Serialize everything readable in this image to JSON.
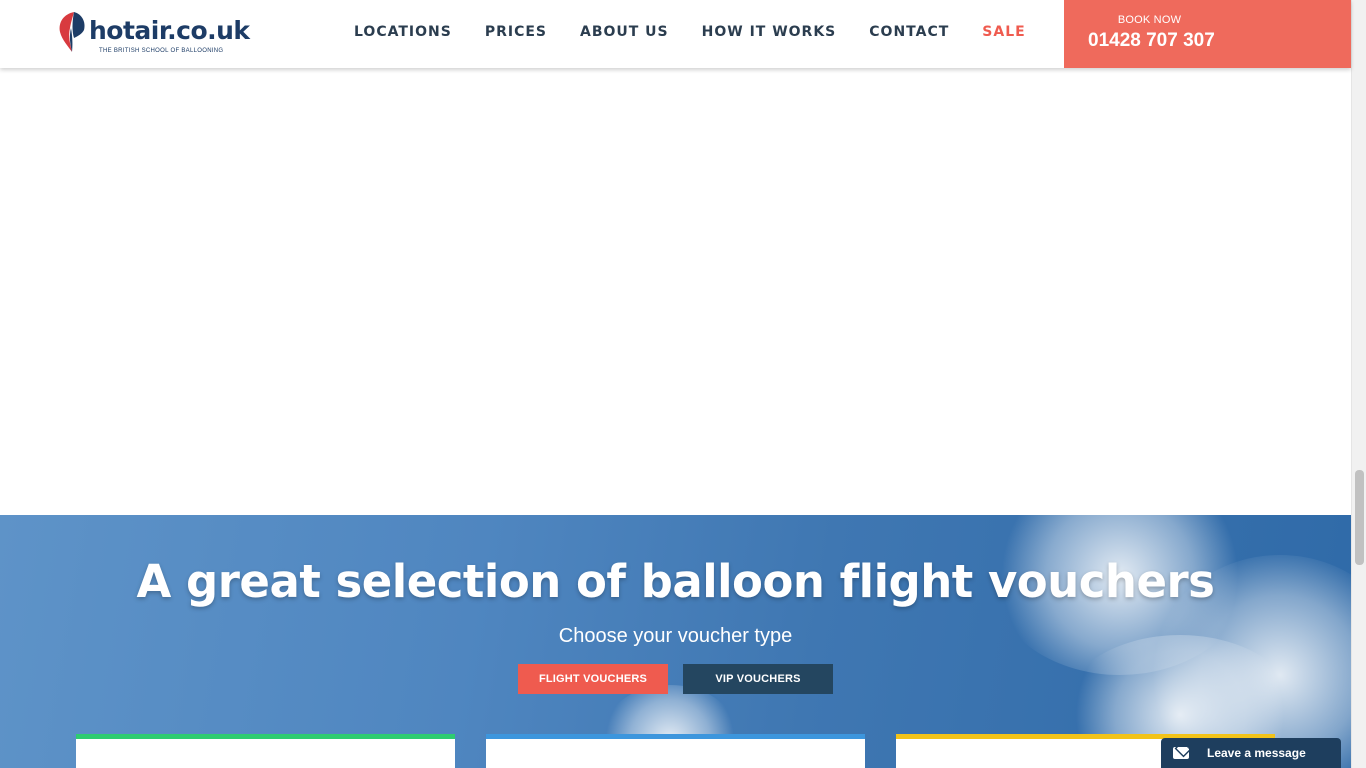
{
  "header": {
    "logo_text": "hotair.co.uk",
    "logo_tagline": "THE BRITISH SCHOOL OF BALLOONING",
    "nav": [
      "LOCATIONS",
      "PRICES",
      "ABOUT US",
      "HOW IT WORKS",
      "CONTACT",
      "SALE"
    ],
    "book_label": "BOOK NOW",
    "book_phone": "01428 707 307"
  },
  "voucher_section": {
    "title": "A great selection of balloon flight vouchers",
    "subtitle": "Choose your voucher type",
    "buttons": [
      "FLIGHT VOUCHERS",
      "VIP VOUCHERS"
    ]
  },
  "chat": {
    "label": "Leave a message",
    "icon": "envelope-icon"
  },
  "colors": {
    "brand_navy": "#1d3c66",
    "accent_red": "#ef5b4f",
    "book_bg": "#ef6a5c",
    "vip_btn": "#244660",
    "card_green": "#2ecc71",
    "card_blue": "#3d96dd",
    "card_yellow": "#f2c319"
  }
}
